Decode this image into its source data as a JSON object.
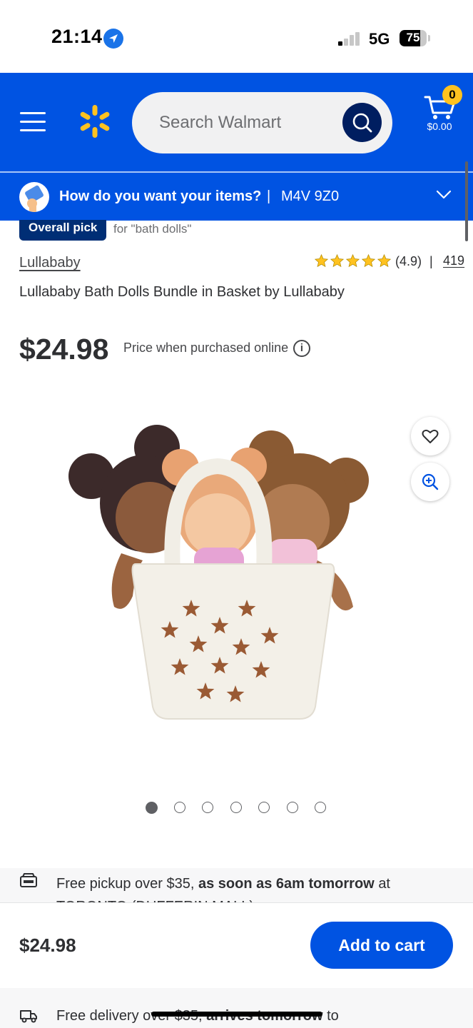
{
  "status_bar": {
    "time": "21:14",
    "network": "5G",
    "battery": "75",
    "battery_level": 0.75,
    "signal_bars_active": 1,
    "signal_bars_total": 4
  },
  "header": {
    "search_placeholder": "Search Walmart",
    "cart_count": "0",
    "cart_total": "$0.00",
    "brand_color": "#0053e2",
    "spark_color": "#ffc220"
  },
  "delivery_bar": {
    "question": "How do you want your items?",
    "separator": "|",
    "zip": "M4V 9Z0"
  },
  "product": {
    "badge": "Overall pick",
    "badge_context": "for \"bath dolls\"",
    "brand": "Lullababy",
    "rating": "(4.9)",
    "rating_value": 4.9,
    "rating_separator": "|",
    "review_count": "419",
    "title": "Lullababy Bath Dolls Bundle in Basket by Lullababy",
    "price": "$24.98",
    "price_note": "Price when purchased online",
    "info_icon": "i"
  },
  "carousel": {
    "total_images": 7,
    "active_index": 0
  },
  "fulfillment": {
    "pickup_prefix": "Free pickup over $35,",
    "pickup_bold": "as soon as 6am tomorrow",
    "pickup_suffix": "at",
    "pickup_store": "TORONTO (DUFFERIN MALL)",
    "delivery_prefix": "Free delivery over $35,",
    "delivery_bold": "arrives tomorrow",
    "delivery_suffix": "to"
  },
  "sticky_bar": {
    "price": "$24.98",
    "add_to_cart": "Add to cart"
  },
  "icons": [
    "location-arrow-icon",
    "signal-icon",
    "battery-icon",
    "menu-icon",
    "walmart-spark-icon",
    "search-icon",
    "cart-icon",
    "delivery-method-icon",
    "chevron-down-icon",
    "star-icon",
    "info-icon",
    "heart-icon",
    "zoom-icon",
    "store-pickup-icon",
    "delivery-truck-icon"
  ]
}
